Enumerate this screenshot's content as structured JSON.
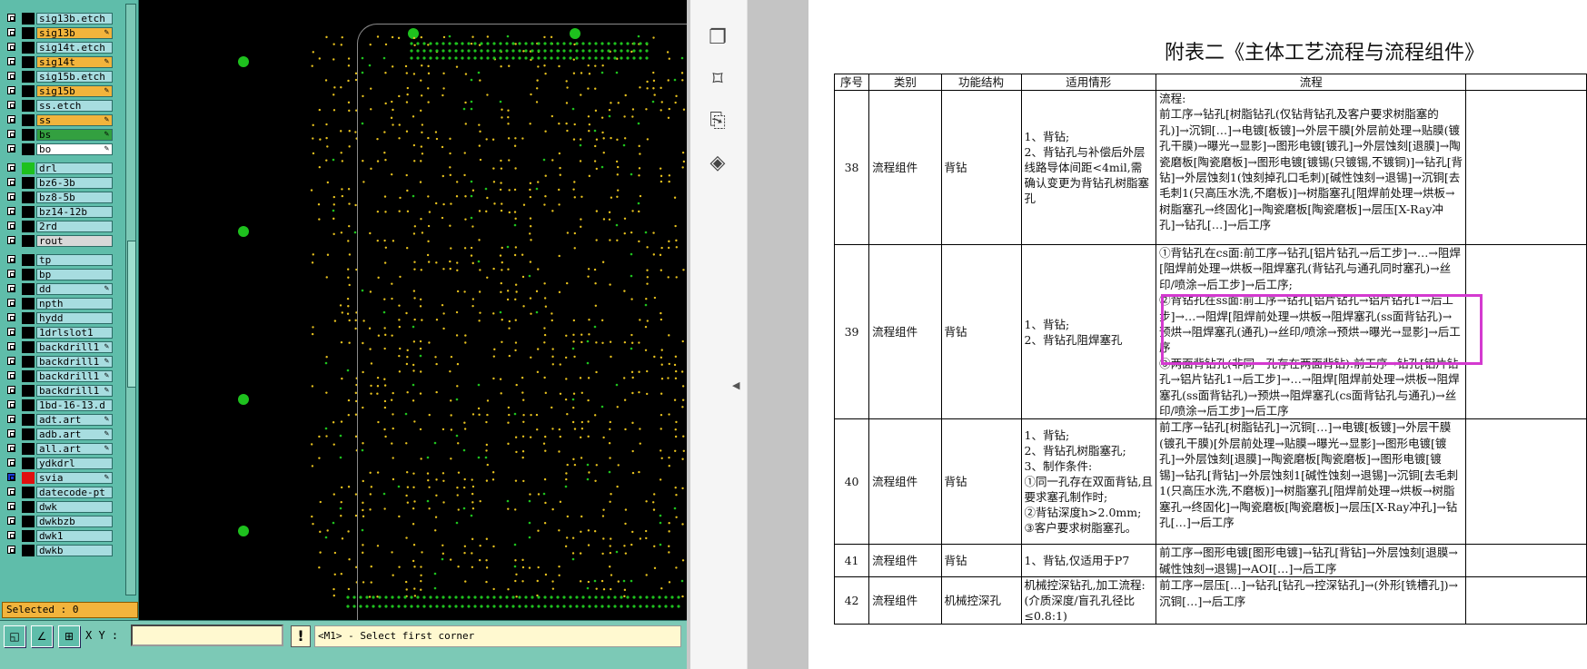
{
  "layer_panel": {
    "layers": [
      {
        "name": "sig13b.etch",
        "color": "#000000",
        "bg": "#a7dde0",
        "pen": false
      },
      {
        "name": "sig13b",
        "color": "#000000",
        "bg": "#f2b43c",
        "pen": true
      },
      {
        "name": "sig14t.etch",
        "color": "#000000",
        "bg": "#a7dde0",
        "pen": false
      },
      {
        "name": "sig14t",
        "color": "#000000",
        "bg": "#f2b43c",
        "pen": true
      },
      {
        "name": "sig15b.etch",
        "color": "#000000",
        "bg": "#a7dde0",
        "pen": false
      },
      {
        "name": "sig15b",
        "color": "#000000",
        "bg": "#f2b43c",
        "pen": true
      },
      {
        "name": "ss.etch",
        "color": "#000000",
        "bg": "#a7dde0",
        "pen": false
      },
      {
        "name": "ss",
        "color": "#000000",
        "bg": "#f2b43c",
        "pen": true
      },
      {
        "name": "bs",
        "color": "#000000",
        "bg": "#33a040",
        "pen": true
      },
      {
        "name": "bo",
        "color": "#000000",
        "bg": "#ffffff",
        "pen": true
      },
      {
        "name": "drl",
        "color": "#1ec11e",
        "bg": "#a7dde0",
        "pen": false,
        "gap": true
      },
      {
        "name": "bz6-3b",
        "color": "#000000",
        "bg": "#a7dde0",
        "pen": false
      },
      {
        "name": "bz8-5b",
        "color": "#000000",
        "bg": "#a7dde0",
        "pen": false
      },
      {
        "name": "bz14-12b",
        "color": "#000000",
        "bg": "#a7dde0",
        "pen": false
      },
      {
        "name": "2rd",
        "color": "#000000",
        "bg": "#a7dde0",
        "pen": false
      },
      {
        "name": "rout",
        "color": "#000000",
        "bg": "#d8d8d8",
        "pen": false
      },
      {
        "name": "tp",
        "color": "#000000",
        "bg": "#a7dde0",
        "pen": false,
        "gap": true
      },
      {
        "name": "bp",
        "color": "#000000",
        "bg": "#a7dde0",
        "pen": false
      },
      {
        "name": "dd",
        "color": "#000000",
        "bg": "#a7dde0",
        "pen": true
      },
      {
        "name": "npth",
        "color": "#000000",
        "bg": "#a7dde0",
        "pen": false
      },
      {
        "name": "hydd",
        "color": "#000000",
        "bg": "#a7dde0",
        "pen": false
      },
      {
        "name": "1drlslot1",
        "color": "#000000",
        "bg": "#a7dde0",
        "pen": false
      },
      {
        "name": "backdrill1",
        "color": "#000000",
        "bg": "#a7dde0",
        "pen": true
      },
      {
        "name": "backdrill1",
        "color": "#000000",
        "bg": "#a7dde0",
        "pen": true
      },
      {
        "name": "backdrill1",
        "color": "#000000",
        "bg": "#a7dde0",
        "pen": true
      },
      {
        "name": "backdrill1",
        "color": "#000000",
        "bg": "#a7dde0",
        "pen": true
      },
      {
        "name": "1bd-16-13.d",
        "color": "#000000",
        "bg": "#a7dde0",
        "pen": false
      },
      {
        "name": "adt.art",
        "color": "#000000",
        "bg": "#a7dde0",
        "pen": true
      },
      {
        "name": "adb.art",
        "color": "#000000",
        "bg": "#a7dde0",
        "pen": true
      },
      {
        "name": "all.art",
        "color": "#000000",
        "bg": "#a7dde0",
        "pen": true
      },
      {
        "name": "ydkdrl",
        "color": "#000000",
        "bg": "#a7dde0",
        "pen": false
      },
      {
        "name": "svia",
        "color": "#e01010",
        "bg": "#a7dde0",
        "pen": true,
        "active": true
      },
      {
        "name": "datecode-pt",
        "color": "#000000",
        "bg": "#a7dde0",
        "pen": false
      },
      {
        "name": "dwk",
        "color": "#000000",
        "bg": "#a7dde0",
        "pen": false
      },
      {
        "name": "dwkbzb",
        "color": "#000000",
        "bg": "#a7dde0",
        "pen": false
      },
      {
        "name": "dwk1",
        "color": "#000000",
        "bg": "#a7dde0",
        "pen": false
      },
      {
        "name": "dwkb",
        "color": "#000000",
        "bg": "#a7dde0",
        "pen": false
      }
    ],
    "selected_text": "Selected : 0"
  },
  "colors": {
    "fiducial": "#1ec11e",
    "drill": "#e8c21e",
    "highlight": "#d43ad0"
  },
  "status_bar": {
    "xy_label": "X Y :",
    "xy_value": "",
    "bang_label": "!",
    "prompt": "<M1> - Select first corner",
    "tools": [
      "select-box-icon",
      "measure-icon",
      "grid-icon"
    ]
  },
  "pdf_sidebar": {
    "icons": [
      "pages-icon",
      "bookmark-icon",
      "attachment-icon",
      "layers-icon"
    ]
  },
  "document": {
    "title": "附表二《主体工艺流程与流程组件》",
    "headers": [
      "序号",
      "类别",
      "功能结构",
      "适用情形",
      "流程"
    ],
    "rows": [
      {
        "no": "38",
        "category": "流程组件",
        "function": "背钻",
        "applicable": "1、背钻;\n2、背钻孔与补偿后外层线路导体间距<4mil,需确认变更为背钻孔树脂塞孔",
        "flow": "流程:\n前工序→钻孔[树脂钻孔(仅钻背钻孔及客户要求树脂塞的孔)]→沉铜[…]→电镀[板镀]→外层干膜[外层前处理→贴膜(镀孔干膜)→曝光→显影]→图形电镀[镀孔]→外层蚀刻[退膜]→陶瓷磨板[陶瓷磨板]→图形电镀[镀锡(只镀锡,不镀铜)]→钻孔[背钻]→外层蚀刻1(蚀刻掉孔口毛刺)[碱性蚀刻→退锡]→沉铜[去毛刺1(只高压水洗,不磨板)]→树脂塞孔[阻焊前处理→烘板→树脂塞孔→终固化]→陶瓷磨板[陶瓷磨板]→层压[X-Ray冲孔]→钻孔[…]→后工序"
      },
      {
        "no": "39",
        "category": "流程组件",
        "function": "背钻",
        "applicable": "1、背钻;\n2、背钻孔阻焊塞孔",
        "flow": "①背钻孔在cs面:前工序→钻孔[铝片钻孔→后工步]→…→阻焊[阻焊前处理→烘板→阻焊塞孔(背钻孔与通孔同时塞孔)→丝印/喷涂→后工步]→后工序;\n②背钻孔在ss面:前工序→钻孔[铝片钻孔→铝片钻孔1→后工步]→…→阻焊[阻焊前处理→烘板→阻焊塞孔(ss面背钻孔)→预烘→阻焊塞孔(通孔)→丝印/喷涂→预烘→曝光→显影]→后工序\n③两面背钻孔(非同一孔存在两面背钻):前工序→钻孔[铝片钻孔→铝片钻孔1→后工步]→…→阻焊[阻焊前处理→烘板→阻焊塞孔(ss面背钻孔)→预烘→阻焊塞孔(cs面背钻孔与通孔)→丝印/喷涂→后工步]→后工序"
      },
      {
        "no": "40",
        "category": "流程组件",
        "function": "背钻",
        "applicable": "1、背钻;\n2、背钻孔树脂塞孔;\n3、制作条件:\n①同一孔存在双面背钻,且要求塞孔制作时;\n②背钻深度h>2.0mm;\n③客户要求树脂塞孔。",
        "flow": "前工序→钻孔[树脂钻孔]→沉铜[…]→电镀[板镀]→外层干膜(镀孔干膜)[外层前处理→贴膜→曝光→显影]→图形电镀[镀孔]→外层蚀刻[退膜]→陶瓷磨板[陶瓷磨板]→图形电镀[镀锡]→钻孔[背钻]→外层蚀刻1[碱性蚀刻→退锡]→沉铜[去毛刺1(只高压水洗,不磨板)]→树脂塞孔[阻焊前处理→烘板→树脂塞孔→终固化]→陶瓷磨板[陶瓷磨板]→层压[X-Ray冲孔]→钻孔[…]→后工序"
      },
      {
        "no": "41",
        "category": "流程组件",
        "function": "背钻",
        "applicable": "1、背钻,仅适用于P7",
        "flow": "前工序→图形电镀[图形电镀]→钻孔[背钻]→外层蚀刻[退膜→碱性蚀刻→退锡]→AOI[…]→后工序"
      },
      {
        "no": "42",
        "category": "流程组件",
        "function": "机械控深孔",
        "applicable": "机械控深钻孔,加工流程:(介质深度/盲孔孔径比≤0.8:1)",
        "flow": "前工序→层压[…]→钻孔[钻孔→控深钻孔]→(外形[铣槽孔])→沉铜[…]→后工序"
      }
    ]
  }
}
